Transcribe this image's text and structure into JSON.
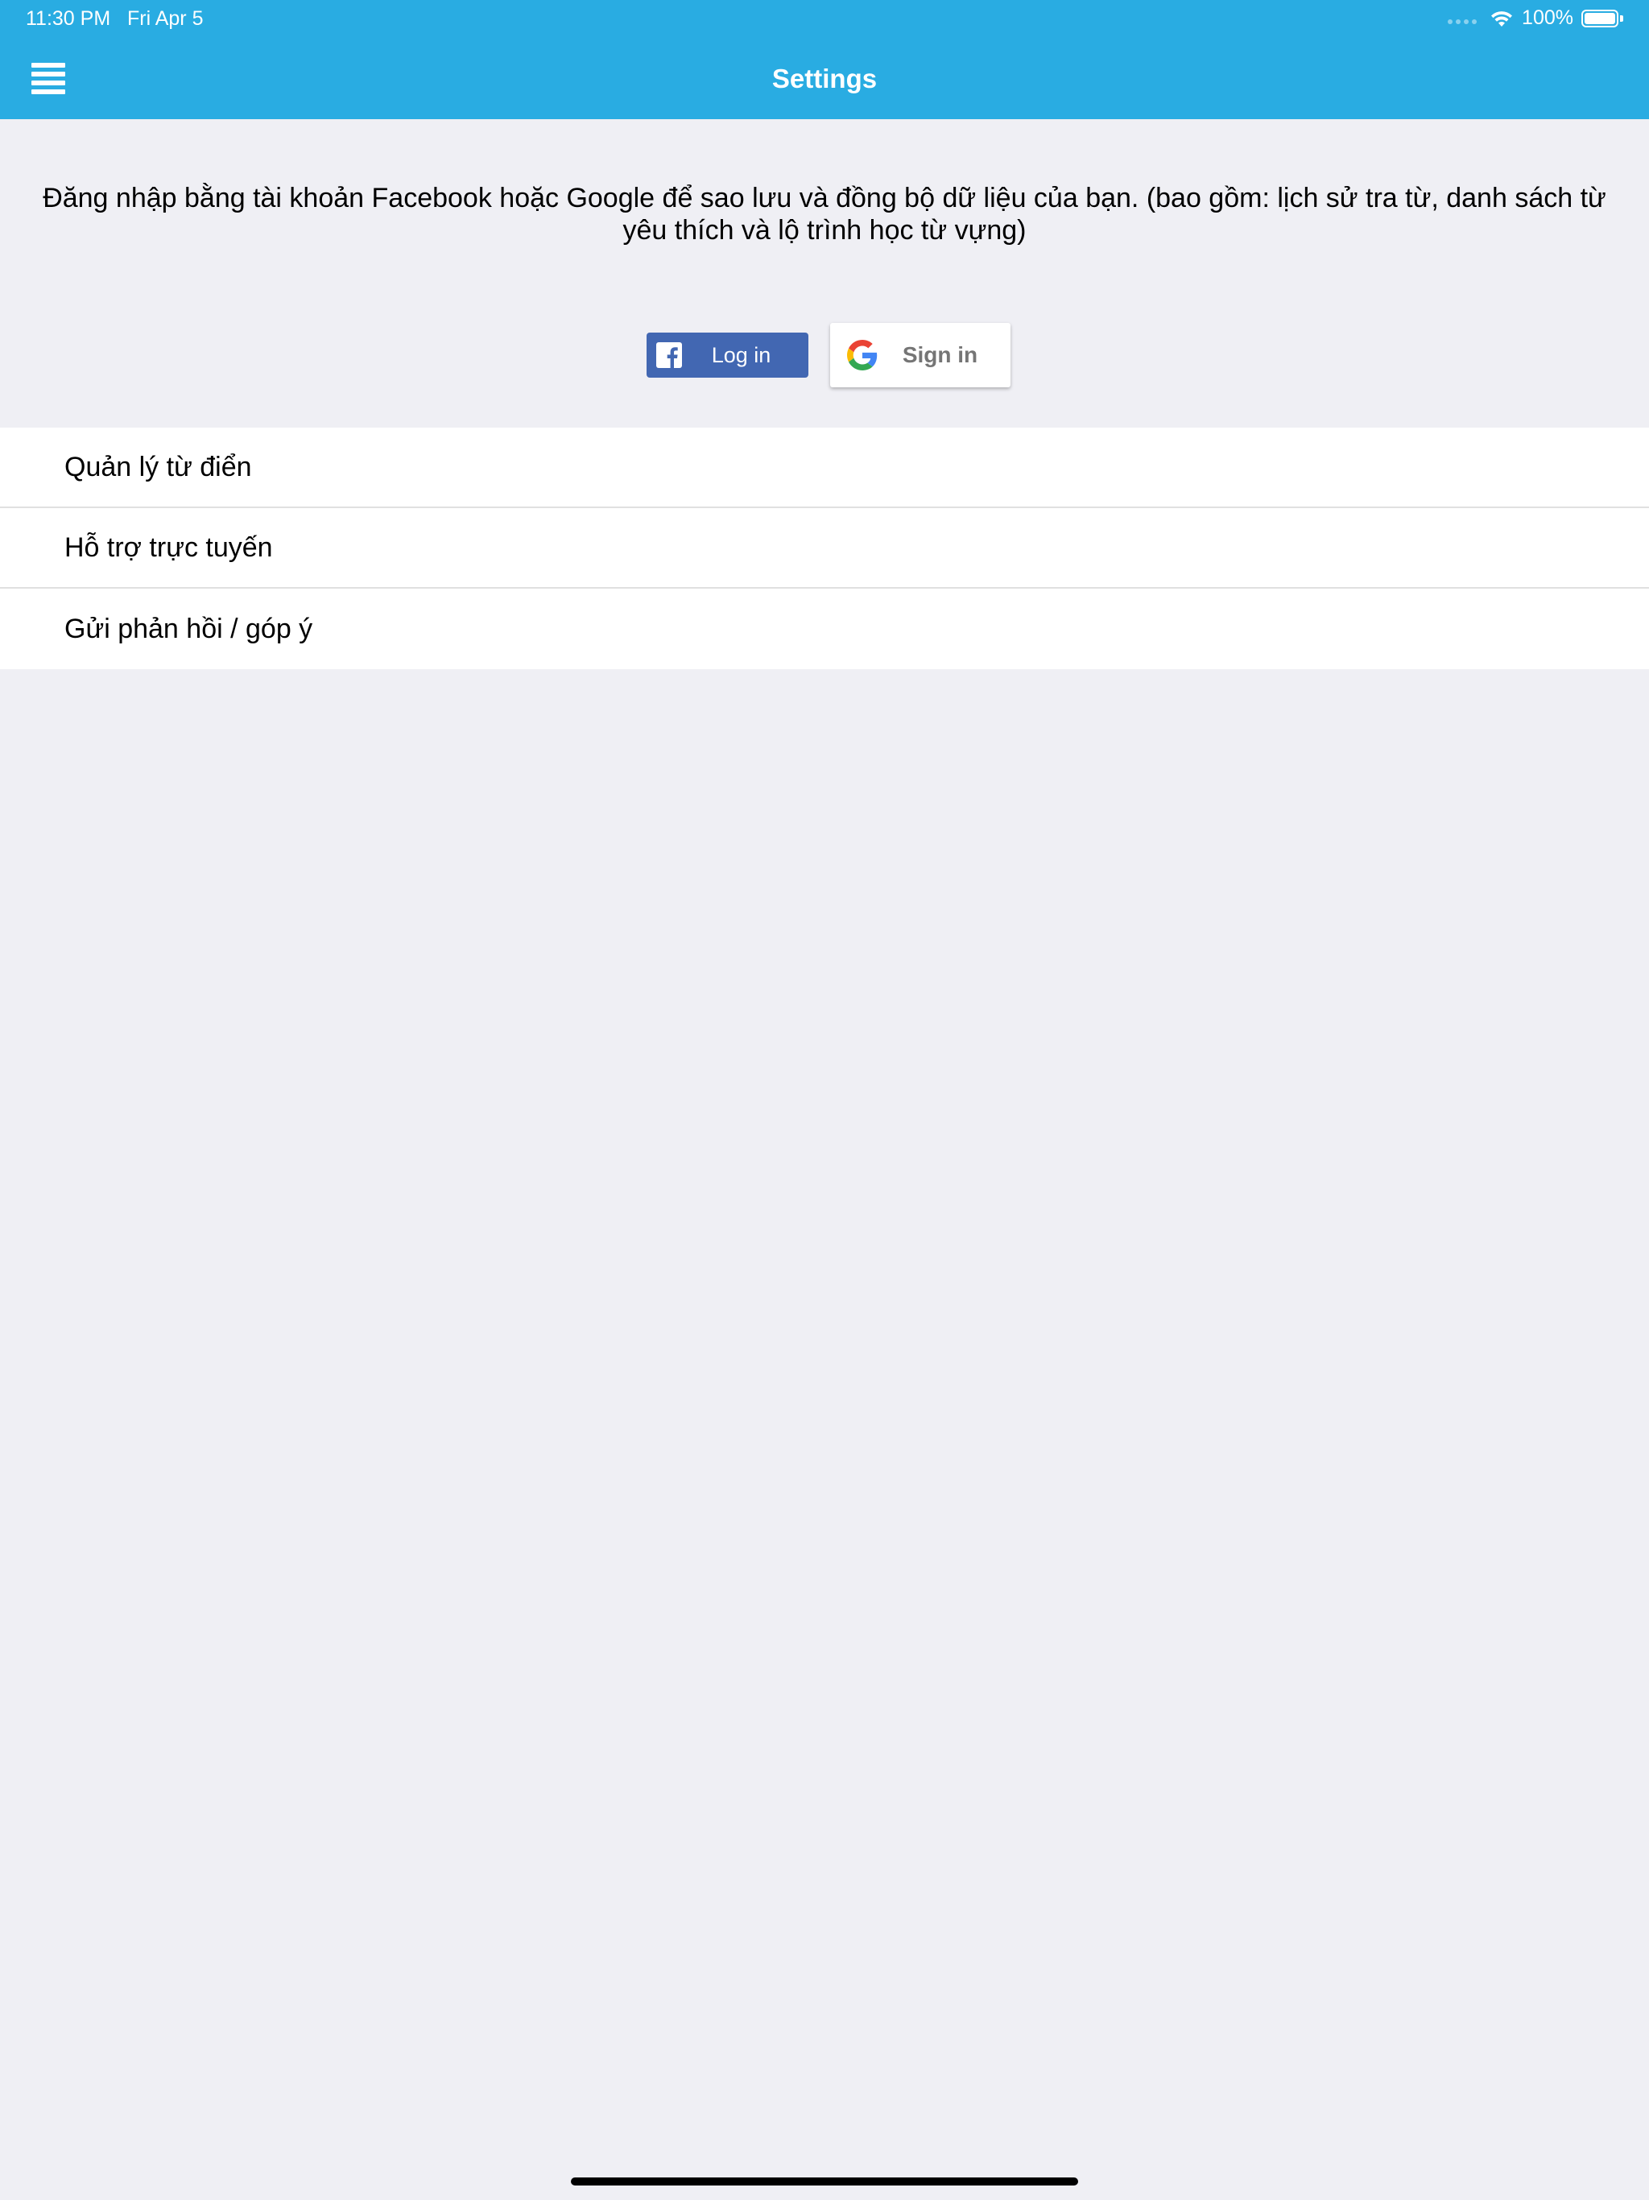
{
  "status_bar": {
    "time": "11:30 PM",
    "date": "Fri Apr 5",
    "battery": "100%",
    "wifi_icon": "wifi-icon",
    "battery_icon": "battery-full-icon"
  },
  "nav": {
    "title": "Settings",
    "menu_icon": "hamburger-menu-icon"
  },
  "intro": {
    "text": "Đăng nhập bằng tài khoản Facebook hoặc Google để sao lưu và đồng bộ dữ liệu của bạn. (bao gồm: lịch sử tra từ, danh sách từ yêu thích và lộ trình học từ vựng)"
  },
  "login": {
    "facebook_label": "Log in",
    "facebook_icon": "facebook-icon",
    "google_label": "Sign in",
    "google_icon": "google-icon"
  },
  "menu_items": [
    {
      "label": "Quản lý từ điển"
    },
    {
      "label": "Hỗ trợ trực tuyến"
    },
    {
      "label": "Gửi phản hồi / góp ý"
    }
  ],
  "colors": {
    "header": "#29ace2",
    "background": "#efeff4",
    "facebook": "#4267b2",
    "google_text": "#757575"
  }
}
